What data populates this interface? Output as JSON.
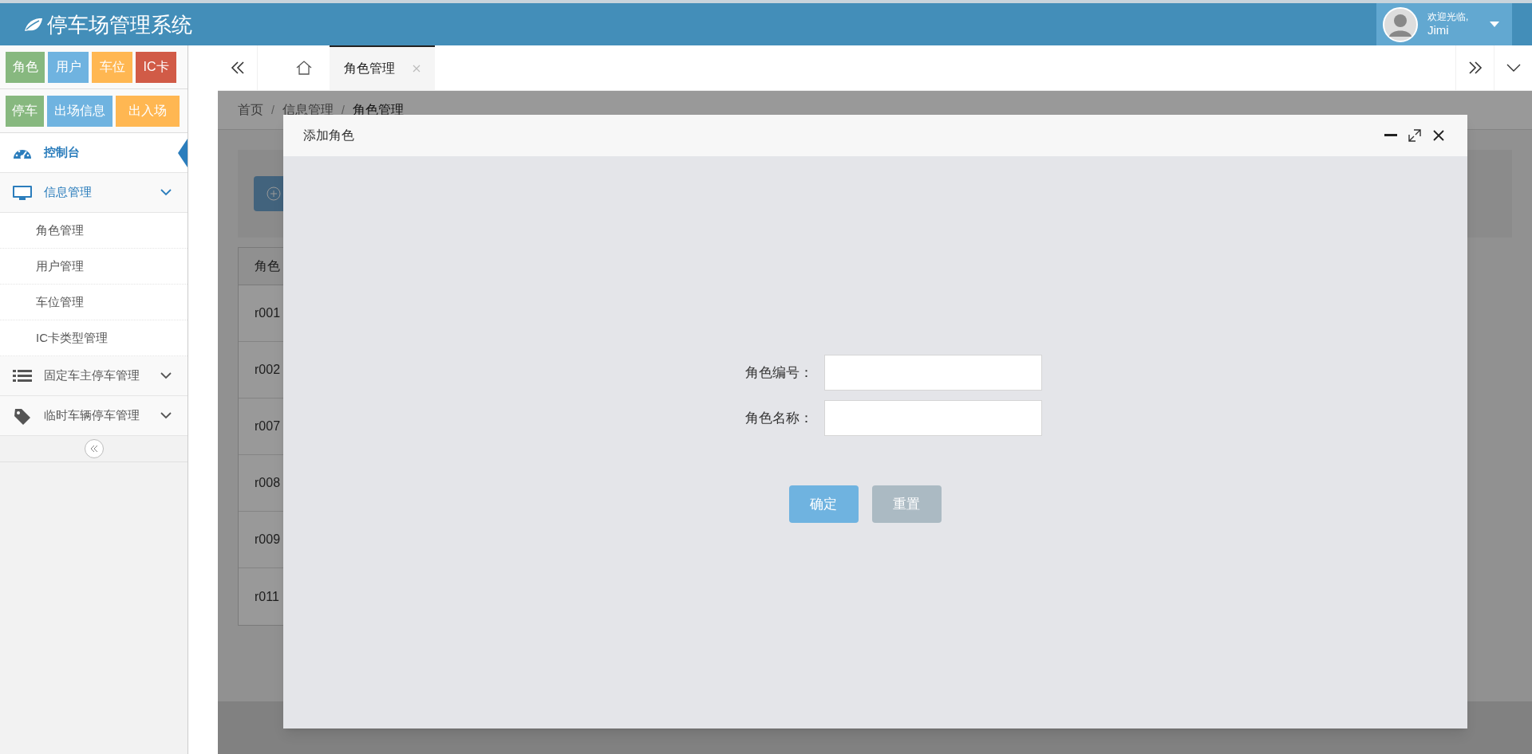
{
  "header": {
    "title": "停车场管理系统",
    "user": {
      "greeting": "欢迎光临,",
      "name": "Jimi"
    }
  },
  "shortcut_rows": [
    {
      "items": [
        {
          "label": "角色",
          "color": "#87b87f"
        },
        {
          "label": "用户",
          "color": "#6fb3e0"
        },
        {
          "label": "车位",
          "color": "#ffb752"
        },
        {
          "label": "IC卡",
          "color": "#d15b47"
        }
      ]
    },
    {
      "items": [
        {
          "label": "停车",
          "color": "#87b87f"
        },
        {
          "label": "出场信息",
          "color": "#6fb3e0"
        },
        {
          "label": "出入场",
          "color": "#ffb752"
        }
      ]
    }
  ],
  "sidebar": {
    "items": [
      {
        "label": "控制台",
        "kind": "link",
        "selected": true
      },
      {
        "label": "信息管理",
        "kind": "group",
        "selected": false,
        "expanded": true,
        "children": [
          {
            "label": "角色管理"
          },
          {
            "label": "用户管理"
          },
          {
            "label": "车位管理"
          },
          {
            "label": "IC卡类型管理"
          }
        ]
      },
      {
        "label": "固定车主停车管理",
        "kind": "group",
        "selected": false,
        "expanded": false
      },
      {
        "label": "临时车辆停车管理",
        "kind": "group",
        "selected": false,
        "expanded": false
      }
    ]
  },
  "tabs": [
    {
      "label": "角色管理",
      "selected": true
    }
  ],
  "breadcrumb": [
    "首页",
    "信息管理",
    "角色管理"
  ],
  "breadcrumb_separators": [
    "/",
    "/"
  ],
  "table": {
    "columns": [
      "角色"
    ],
    "rows": [
      [
        "r001"
      ],
      [
        "r002"
      ],
      [
        "r007"
      ],
      [
        "r008"
      ],
      [
        "r009"
      ],
      [
        "r011"
      ]
    ]
  },
  "dialog": {
    "title": "添加角色",
    "fields": [
      {
        "label": "角色编号："
      },
      {
        "label": "角色名称："
      }
    ],
    "buttons": [
      {
        "label": "确定",
        "kind": "primary"
      },
      {
        "label": "重置",
        "kind": "secondary"
      }
    ]
  }
}
